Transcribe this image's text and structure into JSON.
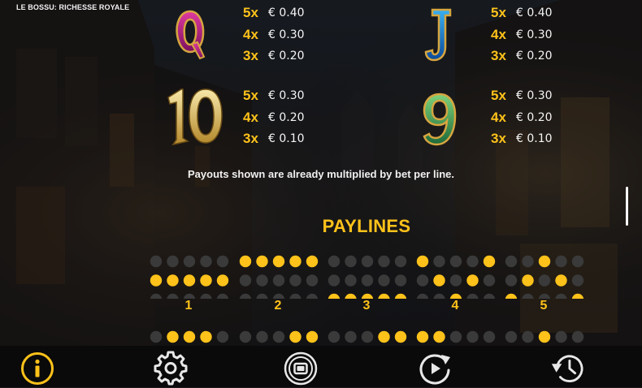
{
  "game": {
    "title": "LE BOSSU: RICHESSE ROYALE"
  },
  "paytable": {
    "symbols": [
      {
        "name": "Q",
        "icon": "letter-q-symbol-icon",
        "payouts": [
          {
            "count": "5x",
            "amount": "€ 0.40"
          },
          {
            "count": "4x",
            "amount": "€ 0.30"
          },
          {
            "count": "3x",
            "amount": "€ 0.20"
          }
        ]
      },
      {
        "name": "J",
        "icon": "letter-j-symbol-icon",
        "payouts": [
          {
            "count": "5x",
            "amount": "€ 0.40"
          },
          {
            "count": "4x",
            "amount": "€ 0.30"
          },
          {
            "count": "3x",
            "amount": "€ 0.20"
          }
        ]
      },
      {
        "name": "10",
        "icon": "number-10-symbol-icon",
        "payouts": [
          {
            "count": "5x",
            "amount": "€ 0.30"
          },
          {
            "count": "4x",
            "amount": "€ 0.20"
          },
          {
            "count": "3x",
            "amount": "€ 0.10"
          }
        ]
      },
      {
        "name": "9",
        "icon": "number-9-symbol-icon",
        "payouts": [
          {
            "count": "5x",
            "amount": "€ 0.30"
          },
          {
            "count": "4x",
            "amount": "€ 0.20"
          },
          {
            "count": "3x",
            "amount": "€ 0.10"
          }
        ]
      }
    ],
    "note": "Payouts shown are already multiplied by bet per line."
  },
  "paylines": {
    "title": "PAYLINES",
    "lines": [
      {
        "number": "1",
        "rows": [
          1,
          1,
          1,
          1,
          1
        ]
      },
      {
        "number": "2",
        "rows": [
          0,
          0,
          0,
          0,
          0
        ]
      },
      {
        "number": "3",
        "rows": [
          2,
          2,
          2,
          2,
          2
        ]
      },
      {
        "number": "4",
        "rows": [
          0,
          1,
          2,
          1,
          0
        ]
      },
      {
        "number": "5",
        "rows": [
          2,
          1,
          0,
          1,
          2
        ]
      }
    ],
    "partial_lines": [
      {
        "rows": [
          1,
          0,
          0,
          0,
          1
        ]
      },
      {
        "rows": [
          1,
          1,
          1,
          0,
          0
        ]
      },
      {
        "rows": [
          1,
          1,
          1,
          0,
          0
        ]
      },
      {
        "rows": [
          0,
          0,
          1,
          1,
          1
        ]
      },
      {
        "rows": [
          1,
          1,
          0,
          1,
          1
        ]
      }
    ],
    "colors": {
      "active": "#ffc21a",
      "inactive": "#3a3a3a"
    }
  },
  "toolbar": {
    "buttons": [
      {
        "icon": "info-icon",
        "active": true
      },
      {
        "icon": "gear-icon",
        "active": false
      },
      {
        "icon": "autoplay-icon",
        "active": false
      },
      {
        "icon": "spin-icon",
        "active": false
      },
      {
        "icon": "history-icon",
        "active": false
      }
    ],
    "colors": {
      "active": "#ffc21a",
      "inactive": "#e8e8e8"
    }
  }
}
